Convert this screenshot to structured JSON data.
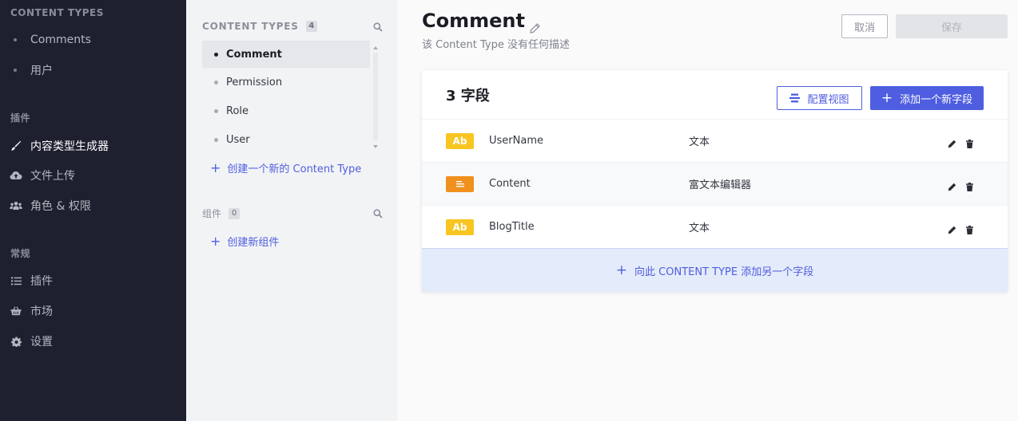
{
  "nav": {
    "section_content_types": "CONTENT TYPES",
    "content_types": [
      {
        "label": "Comments"
      },
      {
        "label": "用户"
      }
    ],
    "section_plugins": "插件",
    "plugins": [
      {
        "label": "内容类型生成器",
        "icon": "brush-icon"
      },
      {
        "label": "文件上传",
        "icon": "cloud-upload-icon"
      },
      {
        "label": "角色 & 权限",
        "icon": "users-icon"
      }
    ],
    "section_general": "常规",
    "general": [
      {
        "label": "插件",
        "icon": "list-icon"
      },
      {
        "label": "市场",
        "icon": "basket-icon"
      },
      {
        "label": "设置",
        "icon": "gear-icon"
      }
    ]
  },
  "ct_panel": {
    "heading": "CONTENT TYPES",
    "count": "4",
    "items": [
      {
        "label": "Comment"
      },
      {
        "label": "Permission"
      },
      {
        "label": "Role"
      },
      {
        "label": "User"
      }
    ],
    "create_link": "创建一个新的 Content Type",
    "components_heading": "组件",
    "components_count": "0",
    "create_component_link": "创建新组件"
  },
  "main": {
    "title": "Comment",
    "description": "该 Content Type 没有任何描述",
    "cancel_label": "取消",
    "save_label": "保存",
    "fields_title": "3 字段",
    "configure_view_label": "配置视图",
    "add_field_label": "添加一个新字段",
    "fields": [
      {
        "type_badge": "Ab",
        "name": "UserName",
        "kind": "文本"
      },
      {
        "type_badge": "",
        "name": "Content",
        "kind": "富文本编辑器"
      },
      {
        "type_badge": "Ab",
        "name": "BlogTitle",
        "kind": "文本"
      }
    ],
    "add_another_label": "向此 CONTENT TYPE 添加另一个字段"
  },
  "colors": {
    "accent": "#4f5ee0",
    "nav_bg": "#1e2030",
    "text_type": "#f8c521",
    "richtext_type": "#f0901e"
  }
}
